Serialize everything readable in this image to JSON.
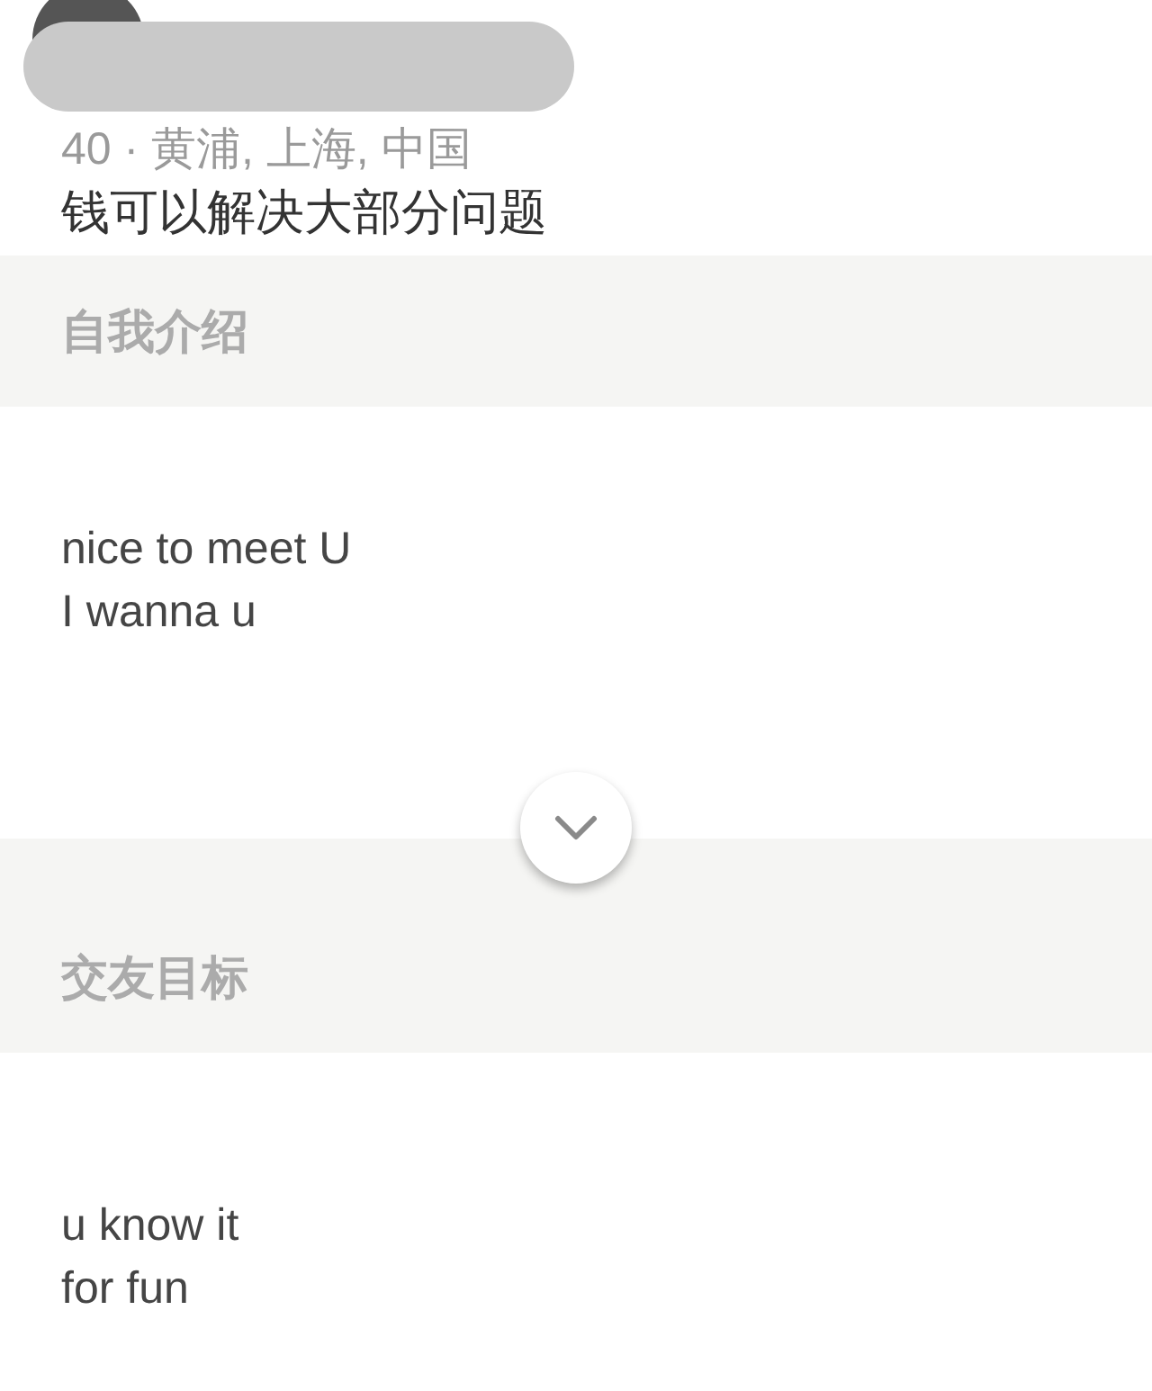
{
  "profile": {
    "age_location": "40 · 黄浦, 上海, 中国",
    "tagline": "钱可以解决大部分问题"
  },
  "sections": [
    {
      "title": "自我介绍",
      "lines": [
        "nice to meet U",
        "I wanna u"
      ],
      "expand_toggle": {
        "expanded": false
      }
    },
    {
      "title": "交友目标",
      "lines": [
        "u know it",
        "for fun"
      ]
    }
  ]
}
